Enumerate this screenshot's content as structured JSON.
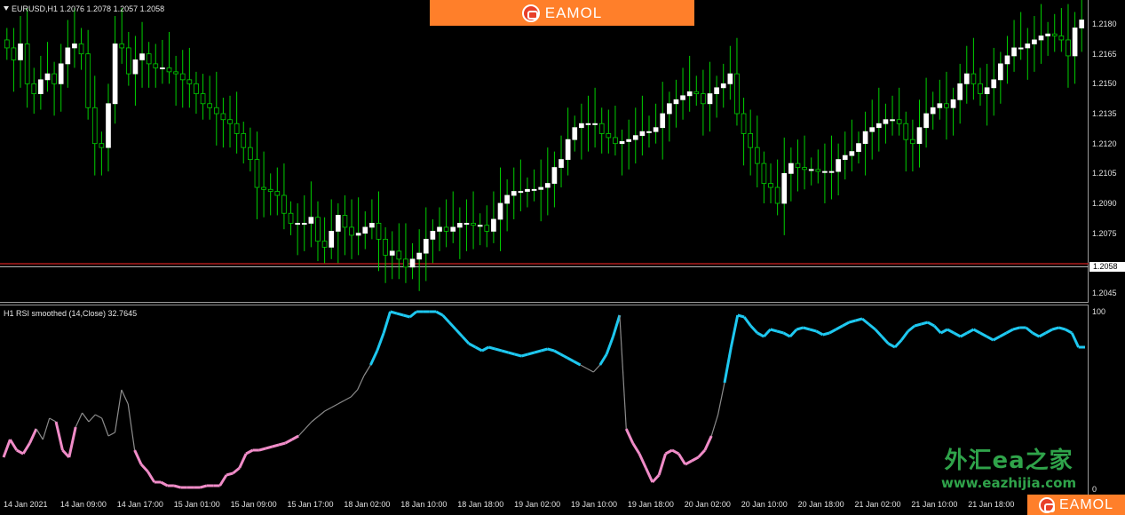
{
  "chart": {
    "symbol_header": "EURUSD,H1  1.2076 1.2078 1.2057 1.2058",
    "indicator_header": "H1 RSI smoothed (14,Close) 32.7645",
    "current_price": "1.2058"
  },
  "branding": {
    "top_logo_text": "EAMOL",
    "bottom_logo_text": "EAMOL",
    "watermark_cn": "外汇ea之家",
    "watermark_url": "www.eazhijia.com"
  },
  "price_axis": [
    "1.2180",
    "1.2165",
    "1.2150",
    "1.2135",
    "1.2120",
    "1.2105",
    "1.2090",
    "1.2075",
    "1.2045"
  ],
  "rsi_axis": [
    "100",
    "0"
  ],
  "time_axis": [
    "14 Jan 2021",
    "14 Jan 09:00",
    "14 Jan 17:00",
    "15 Jan 01:00",
    "15 Jan 09:00",
    "15 Jan 17:00",
    "18 Jan 02:00",
    "18 Jan 10:00",
    "18 Jan 18:00",
    "19 Jan 02:00",
    "19 Jan 10:00",
    "19 Jan 18:00",
    "20 Jan 02:00",
    "20 Jan 10:00",
    "20 Jan 18:00",
    "21 Jan 02:00",
    "21 Jan 10:00",
    "21 Jan 18:00"
  ],
  "colors": {
    "bull_candle": "#ffffff",
    "wick": "#00d000",
    "rsi_high": "#1ec8f0",
    "rsi_low": "#f08cc8",
    "rsi_neutral": "#8c8c8c",
    "price_line_red": "#d02020",
    "brand": "#ff7f2a"
  },
  "chart_data": [
    {
      "type": "candlestick",
      "ylim": [
        1.204,
        1.219
      ],
      "closes": [
        1.2168,
        1.2162,
        1.217,
        1.215,
        1.2145,
        1.2152,
        1.2155,
        1.215,
        1.216,
        1.2168,
        1.217,
        1.2165,
        1.2138,
        1.212,
        1.2118,
        1.214,
        1.217,
        1.2168,
        1.2155,
        1.2162,
        1.2165,
        1.216,
        1.2158,
        1.2158,
        1.2156,
        1.2155,
        1.2152,
        1.215,
        1.2145,
        1.214,
        1.2138,
        1.2135,
        1.2132,
        1.213,
        1.2125,
        1.2118,
        1.2112,
        1.2098,
        1.2097,
        1.2096,
        1.2094,
        1.2085,
        1.208,
        1.208,
        1.208,
        1.2083,
        1.2071,
        1.2068,
        1.2076,
        1.2084,
        1.2078,
        1.2074,
        1.2075,
        1.2078,
        1.208,
        1.2072,
        1.2064,
        1.2066,
        1.2062,
        1.2058,
        1.2062,
        1.2065,
        1.2072,
        1.2076,
        1.2078,
        1.2076,
        1.2078,
        1.208,
        1.208,
        1.2079,
        1.2079,
        1.2076,
        1.2082,
        1.209,
        1.2094,
        1.2096,
        1.2096,
        1.2097,
        1.2097,
        1.2098,
        1.21,
        1.2108,
        1.2112,
        1.2122,
        1.2128,
        1.213,
        1.213,
        1.213,
        1.2125,
        1.2123,
        1.212,
        1.2121,
        1.2122,
        1.2124,
        1.2126,
        1.2126,
        1.2128,
        1.2135,
        1.214,
        1.2142,
        1.2144,
        1.2146,
        1.2145,
        1.214,
        1.2145,
        1.2148,
        1.215,
        1.2155,
        1.2135,
        1.2125,
        1.2118,
        1.211,
        1.21,
        1.2098,
        1.209,
        1.2105,
        1.211,
        1.2108,
        1.2107,
        1.2107,
        1.2106,
        1.2106,
        1.2106,
        1.2112,
        1.2114,
        1.2116,
        1.212,
        1.2126,
        1.2128,
        1.213,
        1.2132,
        1.2132,
        1.213,
        1.2122,
        1.212,
        1.2128,
        1.2135,
        1.2138,
        1.214,
        1.2138,
        1.2142,
        1.215,
        1.2155,
        1.215,
        1.2145,
        1.2148,
        1.2152,
        1.216,
        1.2164,
        1.2168,
        1.2168,
        1.217,
        1.2172,
        1.2174,
        1.2175,
        1.2174,
        1.2172,
        1.2164,
        1.2178,
        1.2182
      ],
      "note_last_close": 1.2058
    },
    {
      "type": "line",
      "title": "H1 RSI smoothed (14,Close)",
      "ylim": [
        0,
        100
      ],
      "values": [
        18,
        28,
        22,
        20,
        26,
        34,
        28,
        40,
        38,
        22,
        18,
        35,
        43,
        38,
        42,
        40,
        30,
        32,
        56,
        48,
        22,
        14,
        10,
        4,
        4,
        2,
        2,
        1,
        1,
        1,
        1,
        2,
        2,
        2,
        8,
        9,
        12,
        20,
        22,
        22,
        23,
        24,
        25,
        26,
        28,
        30,
        34,
        38,
        41,
        44,
        46,
        48,
        50,
        52,
        56,
        64,
        70,
        78,
        88,
        100,
        99,
        98,
        97,
        100,
        102,
        102,
        100,
        98,
        94,
        90,
        86,
        82,
        80,
        78,
        80,
        79,
        78,
        77,
        76,
        75,
        76,
        77,
        78,
        79,
        78,
        76,
        74,
        72,
        70,
        68,
        66,
        70,
        76,
        86,
        98,
        34,
        26,
        20,
        12,
        4,
        8,
        20,
        22,
        20,
        14,
        16,
        18,
        22,
        30,
        42,
        60,
        80,
        98,
        97,
        92,
        88,
        86,
        90,
        89,
        88,
        86,
        90,
        91,
        90,
        89,
        87,
        88,
        90,
        92,
        94,
        95,
        96,
        93,
        90,
        86,
        82,
        80,
        84,
        89,
        92,
        93,
        94,
        92,
        88,
        90,
        88,
        86,
        88,
        90,
        88,
        86,
        84,
        86,
        88,
        90,
        91,
        91,
        88,
        86,
        88,
        90,
        91,
        90,
        88,
        80,
        80
      ],
      "segment_colors_note": "cyan above ~70, pink below ~30, grey otherwise"
    }
  ]
}
